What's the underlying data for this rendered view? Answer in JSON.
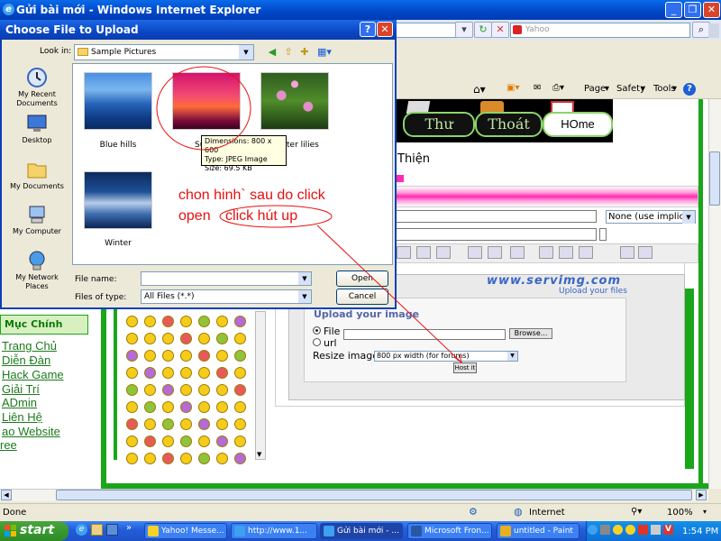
{
  "browser": {
    "window_title": "Gửi bài mới - Windows Internet Explorer",
    "search_placeholder": "Yahoo",
    "commands": [
      "Page",
      "Safety",
      "Tools"
    ]
  },
  "page": {
    "nav": [
      "Thư",
      "Thoát",
      "HOme"
    ],
    "heading_fragment": "Thiện",
    "select_value": "None (use implicit)",
    "sidebar": {
      "heading": "Mục Chính",
      "links": [
        "Trang Chủ",
        "Diễn Đàn",
        "Hack Game",
        "Giải Trí",
        "ADmin",
        "Liên Hệ",
        "ao Website",
        "ree"
      ]
    },
    "servimg": {
      "logo": "www.servimg.com",
      "subtitle": "Upload your files",
      "title": "Upload your image",
      "file_label": "File",
      "url_label": "url",
      "browse_label": "Browse...",
      "resize_label": "Resize image",
      "resize_value": "800 px width (for forums)",
      "host_label": "Host it"
    }
  },
  "dialog": {
    "title": "Choose File to Upload",
    "look_in_label": "Look in:",
    "look_in_value": "Sample Pictures",
    "places": [
      "My Recent Documents",
      "Desktop",
      "My Documents",
      "My Computer",
      "My Network Places"
    ],
    "files": [
      "Blue hills",
      "Sunset",
      "Water lilies",
      "Winter"
    ],
    "visible_file_labels": [
      "Blue hills",
      "Su",
      "ter lilies",
      "Winter"
    ],
    "file_name_label": "File name:",
    "file_name_value": "",
    "files_of_type_label": "Files of type:",
    "files_of_type_value": "All Files (*.*)",
    "open_label": "Open",
    "cancel_label": "Cancel"
  },
  "tooltip": {
    "dimensions": "Dimensions: 800 x 600",
    "type": "Type: JPEG Image",
    "size": "Size: 69.5 KB"
  },
  "annotation": {
    "line1": "chon hinh` sau do click",
    "line2_prefix": "open",
    "line2_circled": "click hút up",
    "color": "#e81010"
  },
  "status": {
    "left": "Done",
    "zone": "Internet",
    "zoom": "100%"
  },
  "taskbar": {
    "start_label": "start",
    "tasks": [
      "Yahoo! Messe...",
      "http://www.1...",
      "Gửi bài mới - ...",
      "Microsoft Fron...",
      "untitled - Paint"
    ],
    "clock": "1:54 PM"
  }
}
